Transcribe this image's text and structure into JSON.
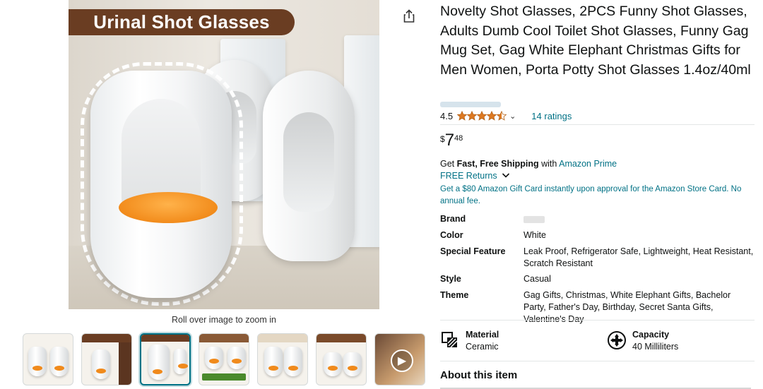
{
  "image": {
    "banner": "Urinal Shot Glasses",
    "zoom_hint": "Roll over image to zoom in",
    "share_icon": "share-icon",
    "thumbnails": [
      {
        "name": "thumb-pair"
      },
      {
        "name": "thumb-size-info"
      },
      {
        "name": "thumb-urinal-shot-glasses",
        "active": true
      },
      {
        "name": "thumb-why-choose"
      },
      {
        "name": "thumb-2pcs"
      },
      {
        "name": "thumb-gifts"
      },
      {
        "name": "thumb-video",
        "icon": "play-icon"
      }
    ]
  },
  "product": {
    "title": "Novelty Shot Glasses, 2PCS Funny Shot Glasses, Adults Dumb Cool Toilet Shot Glasses, Funny Gag Mug Set, Gag White Elephant Christmas Gifts for Men Women, Porta Potty Shot Glasses 1.4oz/40ml",
    "rating": "4.5",
    "rating_fraction": 0.9,
    "ratings_count": "14 ratings",
    "price": {
      "symbol": "$",
      "whole": "7",
      "fraction": "48"
    },
    "shipping": {
      "prefix": "Get ",
      "bold": "Fast, Free Shipping",
      "middle": " with ",
      "link": "Amazon Prime"
    },
    "returns": "FREE Returns",
    "gift_card": "Get a $80 Amazon Gift Card instantly upon approval for the Amazon Store Card. No annual fee."
  },
  "specs": [
    {
      "label": "Brand",
      "value": ""
    },
    {
      "label": "Color",
      "value": "White"
    },
    {
      "label": "Special Feature",
      "value": "Leak Proof, Refrigerator Safe, Lightweight, Heat Resistant, Scratch Resistant"
    },
    {
      "label": "Style",
      "value": "Casual"
    },
    {
      "label": "Theme",
      "value": "Gag Gifts, Christmas, White Elephant Gifts, Bachelor Party, Father's Day, Birthday, Secret Santa Gifts, Valentine's Day"
    }
  ],
  "features": [
    {
      "label": "Material",
      "value": "Ceramic",
      "icon": "material-icon"
    },
    {
      "label": "Capacity",
      "value": "40 Milliliters",
      "icon": "capacity-icon"
    }
  ],
  "about_heading": "About this item",
  "colors": {
    "link": "#007185",
    "star": "#de7921",
    "banner": "#6a3d22"
  }
}
